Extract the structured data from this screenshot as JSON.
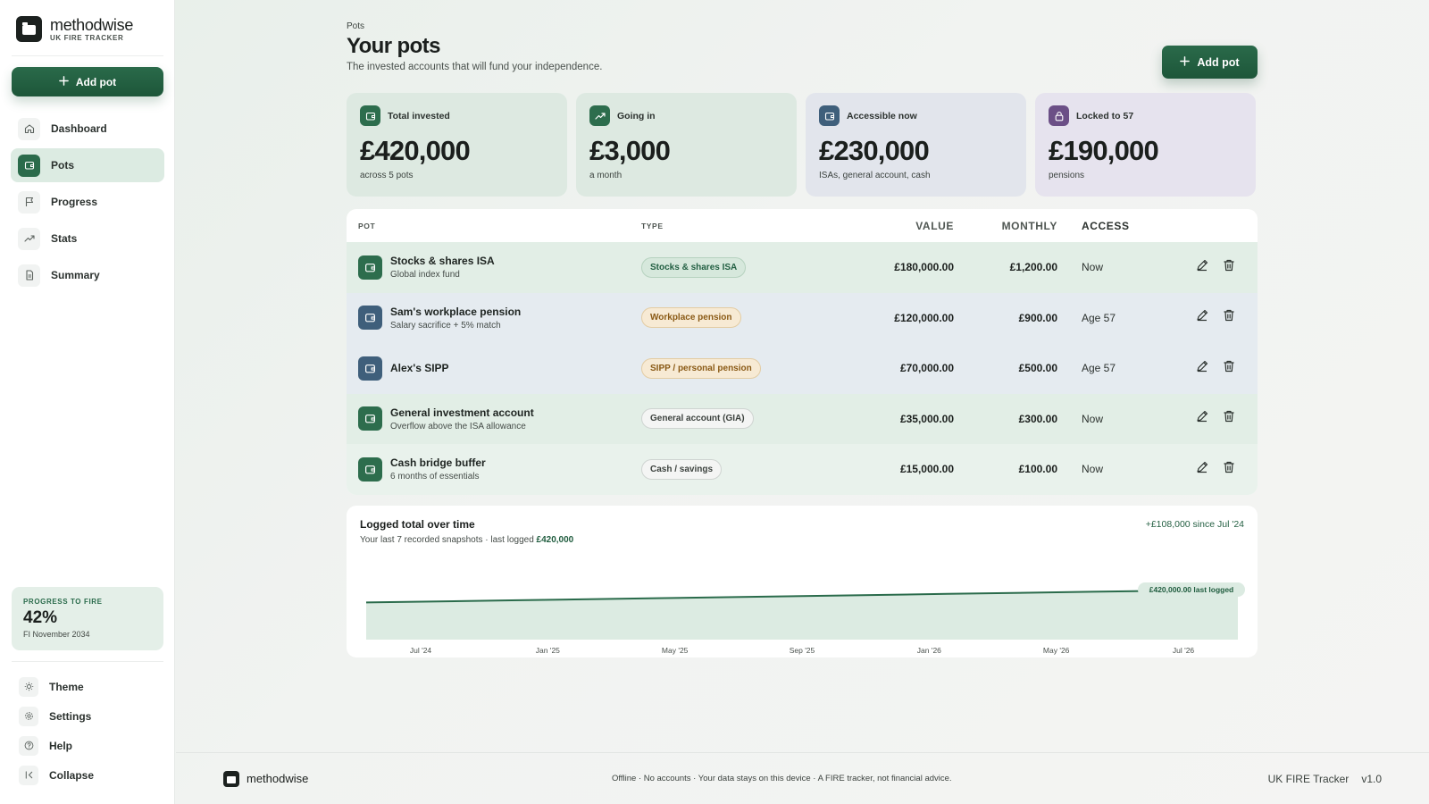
{
  "brand": {
    "name": "methodwise",
    "subtitle": "UK FIRE TRACKER"
  },
  "sidebar": {
    "add_pot_label": "Add pot",
    "nav": [
      {
        "label": "Dashboard",
        "icon": "home-icon"
      },
      {
        "label": "Pots",
        "icon": "wallet-icon",
        "active": true
      },
      {
        "label": "Progress",
        "icon": "flag-icon"
      },
      {
        "label": "Stats",
        "icon": "trend-icon"
      },
      {
        "label": "Summary",
        "icon": "document-icon"
      }
    ],
    "progress": {
      "label": "PROGRESS TO FIRE",
      "value": "42%",
      "sub": "FI November 2034"
    },
    "bottom": [
      {
        "label": "Theme",
        "icon": "sun-icon"
      },
      {
        "label": "Settings",
        "icon": "gear-icon"
      },
      {
        "label": "Help",
        "icon": "help-icon"
      },
      {
        "label": "Collapse",
        "icon": "collapse-icon"
      }
    ]
  },
  "header": {
    "breadcrumb": "Pots",
    "title": "Your pots",
    "subtitle": "The invested accounts that will fund your independence.",
    "add_pot_label": "Add pot"
  },
  "cards": [
    {
      "label": "Total invested",
      "value": "£420,000",
      "sub": "across 5 pots",
      "icon": "wallet-icon",
      "bg": "#dde9e1",
      "icon_bg": "#2d6d4d"
    },
    {
      "label": "Going in",
      "value": "£3,000",
      "sub": "a month",
      "icon": "trend-icon",
      "bg": "#dde9e1",
      "icon_bg": "#2d6d4d"
    },
    {
      "label": "Accessible now",
      "value": "£230,000",
      "sub": "ISAs, general account, cash",
      "icon": "wallet-icon",
      "bg": "#e2e5ec",
      "icon_bg": "#3f5f7b"
    },
    {
      "label": "Locked to 57",
      "value": "£190,000",
      "sub": "pensions",
      "icon": "lock-icon",
      "bg": "#e6e3ee",
      "icon_bg": "#6b4f86"
    }
  ],
  "table": {
    "headers": {
      "pot": "POT",
      "type": "TYPE",
      "value": "VALUE",
      "monthly": "MONTHLY",
      "access": "ACCESS"
    },
    "rows": [
      {
        "name": "Stocks & shares ISA",
        "desc": "Global index fund",
        "type": "Stocks & shares ISA",
        "type_style": "green",
        "value": "£180,000.00",
        "monthly": "£1,200.00",
        "access": "Now",
        "row_style": "g",
        "icon_style": "green"
      },
      {
        "name": "Sam's workplace pension",
        "desc": "Salary sacrifice + 5% match",
        "type": "Workplace pension",
        "type_style": "amber",
        "value": "£120,000.00",
        "monthly": "£900.00",
        "access": "Age 57",
        "row_style": "b",
        "icon_style": "blue"
      },
      {
        "name": "Alex's SIPP",
        "desc": "",
        "type": "SIPP / personal pension",
        "type_style": "amber",
        "value": "£70,000.00",
        "monthly": "£500.00",
        "access": "Age 57",
        "row_style": "b",
        "icon_style": "blue"
      },
      {
        "name": "General investment account",
        "desc": "Overflow above the ISA allowance",
        "type": "General account (GIA)",
        "type_style": "neutral",
        "value": "£35,000.00",
        "monthly": "£300.00",
        "access": "Now",
        "row_style": "g",
        "icon_style": "green"
      },
      {
        "name": "Cash bridge buffer",
        "desc": "6 months of essentials",
        "type": "Cash / savings",
        "type_style": "neutral",
        "value": "£15,000.00",
        "monthly": "£100.00",
        "access": "Now",
        "row_style": "l",
        "icon_style": "green"
      }
    ]
  },
  "chart": {
    "title": "Logged total over time",
    "sub_prefix": "Your last 7 recorded snapshots · last logged ",
    "sub_value": "£420,000",
    "delta": "+£108,000 since Jul '24",
    "last_label": "£420,000.00 last logged"
  },
  "chart_data": {
    "type": "area",
    "x": [
      "Jul '24",
      "Jan '25",
      "May '25",
      "Sep '25",
      "Jan '26",
      "May '26",
      "Jul '26"
    ],
    "values": [
      312000,
      330000,
      348000,
      366000,
      384000,
      402000,
      420000
    ],
    "ylim": [
      0,
      600000
    ],
    "line_color": "#2a6b4b",
    "fill_color": "#dcebe2"
  },
  "footer": {
    "brand": "methodwise",
    "note": "Offline · No accounts · Your data stays on this device · A FIRE tracker, not financial advice.",
    "app_name": "UK FIRE Tracker",
    "version": "v1.0"
  }
}
